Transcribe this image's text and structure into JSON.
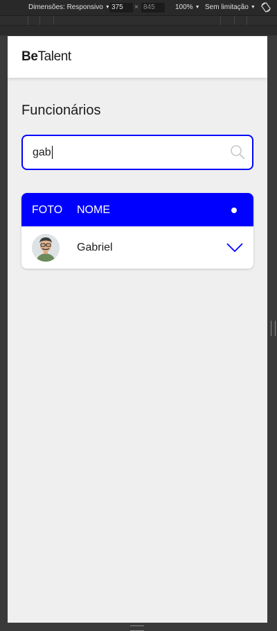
{
  "devtools": {
    "dimensions_label": "Dimensões: Responsivo",
    "width": "375",
    "times": "×",
    "height": "845",
    "zoom": "100%",
    "throttle": "Sem limitação"
  },
  "header": {
    "logo_bold": "Be",
    "logo_light": "Talent"
  },
  "page": {
    "title": "Funcionários"
  },
  "search": {
    "value": "gab"
  },
  "table": {
    "columns": [
      "FOTO",
      "NOME"
    ],
    "rows": [
      {
        "name": "Gabriel"
      }
    ]
  },
  "colors": {
    "primary": "#0000FF",
    "background": "#EFEFEF",
    "header_bg": "#FFFFFF"
  },
  "icons": {
    "search": "search-icon",
    "expand": "chevron-down-icon",
    "rotate": "rotate-icon"
  }
}
